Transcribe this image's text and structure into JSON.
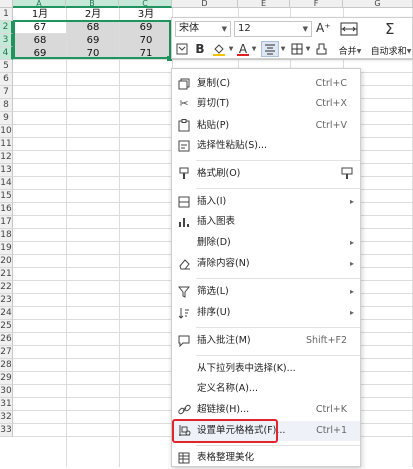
{
  "columns": [
    "A",
    "B",
    "C",
    "D",
    "E",
    "F",
    "G"
  ],
  "rows": [
    "1",
    "2",
    "3",
    "4",
    "5",
    "6",
    "7",
    "8",
    "9",
    "10",
    "11",
    "12",
    "13",
    "14",
    "15",
    "16",
    "17",
    "18",
    "19",
    "20",
    "21",
    "22",
    "23",
    "24",
    "25",
    "26",
    "27",
    "28",
    "29",
    "30",
    "31",
    "32",
    "33"
  ],
  "table": {
    "headers": [
      "1月",
      "2月",
      "3月"
    ],
    "data": [
      [
        "67",
        "68",
        "69"
      ],
      [
        "68",
        "69",
        "70"
      ],
      [
        "69",
        "70",
        "71"
      ]
    ]
  },
  "mini_toolbar": {
    "font_name": "宋体",
    "font_size": "12",
    "bold": "B",
    "font_color_glyph": "A",
    "merge_label": "合并",
    "autosum_label": "自动求和"
  },
  "menu": {
    "copy": {
      "label": "复制(C)",
      "shortcut": "Ctrl+C"
    },
    "cut": {
      "label": "剪切(T)",
      "shortcut": "Ctrl+X"
    },
    "paste": {
      "label": "粘贴(P)",
      "shortcut": "Ctrl+V"
    },
    "paste_special": {
      "label": "选择性粘贴(S)..."
    },
    "format_painter": {
      "label": "格式刷(O)"
    },
    "insert": {
      "label": "插入(I)"
    },
    "insert_chart": {
      "label": "插入图表"
    },
    "delete": {
      "label": "删除(D)"
    },
    "clear": {
      "label": "清除内容(N)"
    },
    "filter": {
      "label": "筛选(L)"
    },
    "sort": {
      "label": "排序(U)"
    },
    "insert_comment": {
      "label": "插入批注(M)",
      "shortcut": "Shift+F2"
    },
    "pick_from_list": {
      "label": "从下拉列表中选择(K)..."
    },
    "define_name": {
      "label": "定义名称(A)..."
    },
    "hyperlink": {
      "label": "超链接(H)...",
      "shortcut": "Ctrl+K"
    },
    "format_cells": {
      "label": "设置单元格格式(F)...",
      "shortcut": "Ctrl+1"
    },
    "table_beautify": {
      "label": "表格整理美化"
    }
  },
  "colors": {
    "selection": "#20945e",
    "highlight_box": "#e0262b",
    "font_color_bar": "#e02020"
  }
}
